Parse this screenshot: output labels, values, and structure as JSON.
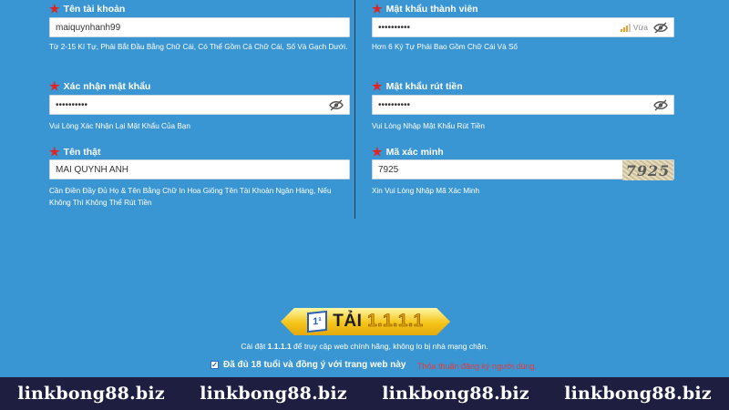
{
  "form": {
    "username": {
      "label": "Tên tài khoản",
      "value": "maiquynhanh99",
      "hint": "Từ 2-15 Kí Tự, Phải Bắt Đầu Bằng Chữ Cái, Có Thể Gồm Cả Chữ Cái, Số Và Gạch Dưới."
    },
    "password": {
      "label": "Mật khẩu thành viên",
      "value": "••••••••••",
      "strength": "Vừa",
      "strength_level": 3,
      "strength_max": 4,
      "hint": "Hơn 6 Ký Tự Phải Bao Gồm Chữ Cái Và Số"
    },
    "confirm_password": {
      "label": "Xác nhận mật khẩu",
      "value": "••••••••••",
      "hint": "Vui Lòng Xác Nhận Lại Mật Khẩu Của Bạn"
    },
    "withdraw_password": {
      "label": "Mật khẩu rút tiền",
      "value": "••••••••••",
      "hint": "Vui Lòng Nhập Mật Khẩu Rút Tiền"
    },
    "real_name": {
      "label": "Tên thật",
      "value": "MAI QUYNH ANH",
      "hint": "Cần Điền Đầy Đủ Họ & Tên Bằng Chữ In Hoa Giống Tên Tài Khoản Ngân Hàng, Nếu Không Thì Không Thể Rút Tiền"
    },
    "captcha": {
      "label": "Mã xác minh",
      "value": "7925",
      "image_text": "7925",
      "hint": "Xin Vui Lòng Nhập Mã Xác Minh"
    },
    "required_mark": "★"
  },
  "banner": {
    "logo_text": "1¹",
    "label": "TẢI",
    "number": "1.1.1.1"
  },
  "install_note": {
    "prefix": "Cài đặt ",
    "bold": "1.1.1.1",
    "suffix": " để truy cập web chính hãng, không lo bị nhà mạng chặn."
  },
  "agree": {
    "checked": "✓",
    "text": "Đã đủ 18 tuổi và đồng ý với trang web này",
    "terms_link": "Thỏa thuận đăng ký người dùng."
  },
  "footer": {
    "watermarks": [
      "linkbong88.biz",
      "linkbong88.biz",
      "linkbong88.biz",
      "linkbong88.biz"
    ]
  },
  "colors": {
    "background": "#3a96d2",
    "footer": "#1e1e40",
    "required": "#e02424",
    "terms": "#e33b3b",
    "banner": "#f5c518"
  }
}
